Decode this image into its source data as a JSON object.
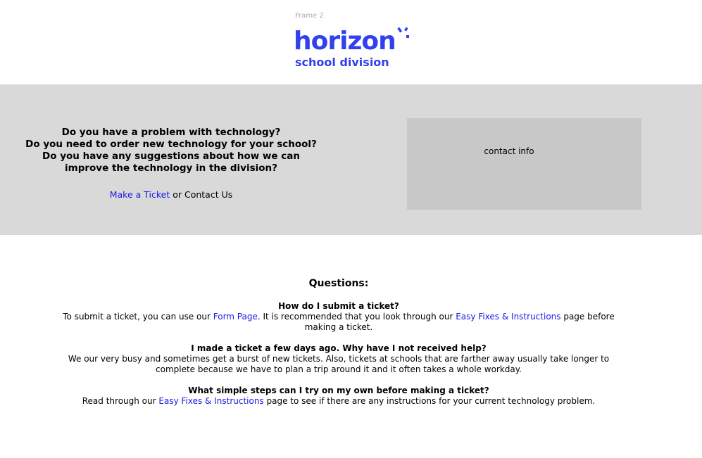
{
  "frame_label": "Frame 2",
  "logo": {
    "wordmark": "horizon",
    "subtitle": "school division",
    "brand_color": "#3140f0"
  },
  "hero": {
    "questions": [
      "Do you have a problem with technology?",
      "Do you need to order new technology for your school?",
      "Do you have any suggestions about how we can improve the technology in the division?"
    ],
    "cta_link": "Make a Ticket",
    "cta_rest": " or Contact Us"
  },
  "contact": {
    "label": "contact info"
  },
  "faq": {
    "title": "Questions:",
    "items": [
      {
        "question": "How do I submit a ticket?",
        "a1": "To submit a ticket, you can use our ",
        "link1": "Form Page",
        "a2": ". It is recommended that you look through our ",
        "link2": "Easy Fixes & Instructions",
        "a3": " page before making a ticket."
      },
      {
        "question": "I made a ticket a few days ago. Why have I not received help?",
        "answer": "We our very busy and sometimes get a burst of new tickets. Also, tickets at schools that are farther away usually take longer to complete because we have to plan a trip around it and it often takes a whole workday."
      },
      {
        "question": "What simple steps can I try on my own before making a ticket?",
        "a1": "Read through our ",
        "link1": "Easy Fixes & Instructions",
        "a2": " page to see if there are any instructions for your current technology problem."
      }
    ]
  },
  "link_color": "#1a1ae6"
}
